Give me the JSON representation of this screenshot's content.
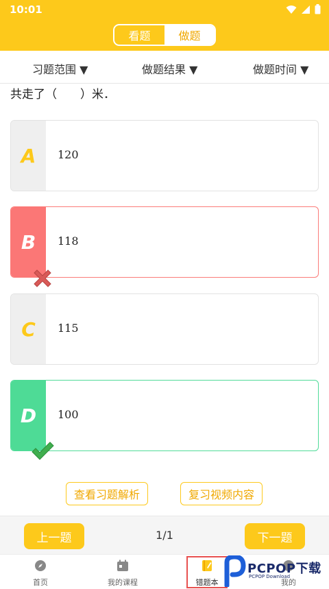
{
  "status": {
    "time": "10:01"
  },
  "header": {
    "tabs": [
      {
        "label": "看题"
      },
      {
        "label": "做题"
      }
    ]
  },
  "filters": {
    "range": "习题范围 ▼",
    "result": "做题结果 ▼",
    "time": "做题时间 ▼"
  },
  "question": {
    "text": "共走了（　　）米．"
  },
  "options": [
    {
      "letter": "A",
      "value": "120",
      "state": "normal"
    },
    {
      "letter": "B",
      "value": "118",
      "state": "wrong"
    },
    {
      "letter": "C",
      "value": "115",
      "state": "normal"
    },
    {
      "letter": "D",
      "value": "100",
      "state": "correct"
    }
  ],
  "actions": {
    "analysis": "查看习题解析",
    "video": "复习视频内容"
  },
  "pager": {
    "prev": "上一题",
    "count": "1/1",
    "next": "下一题"
  },
  "nav": [
    {
      "label": "首页",
      "icon": "compass-icon"
    },
    {
      "label": "我的课程",
      "icon": "calendar-icon"
    },
    {
      "label": "错题本",
      "icon": "notebook-icon",
      "active": true
    },
    {
      "label": "我的",
      "icon": "user-icon"
    }
  ],
  "watermark": {
    "text": "PCPOP下载",
    "sub": "PCPOP Download"
  },
  "colors": {
    "accent": "#FDC91B",
    "wrong": "#FB7776",
    "correct": "#4EDB96"
  }
}
